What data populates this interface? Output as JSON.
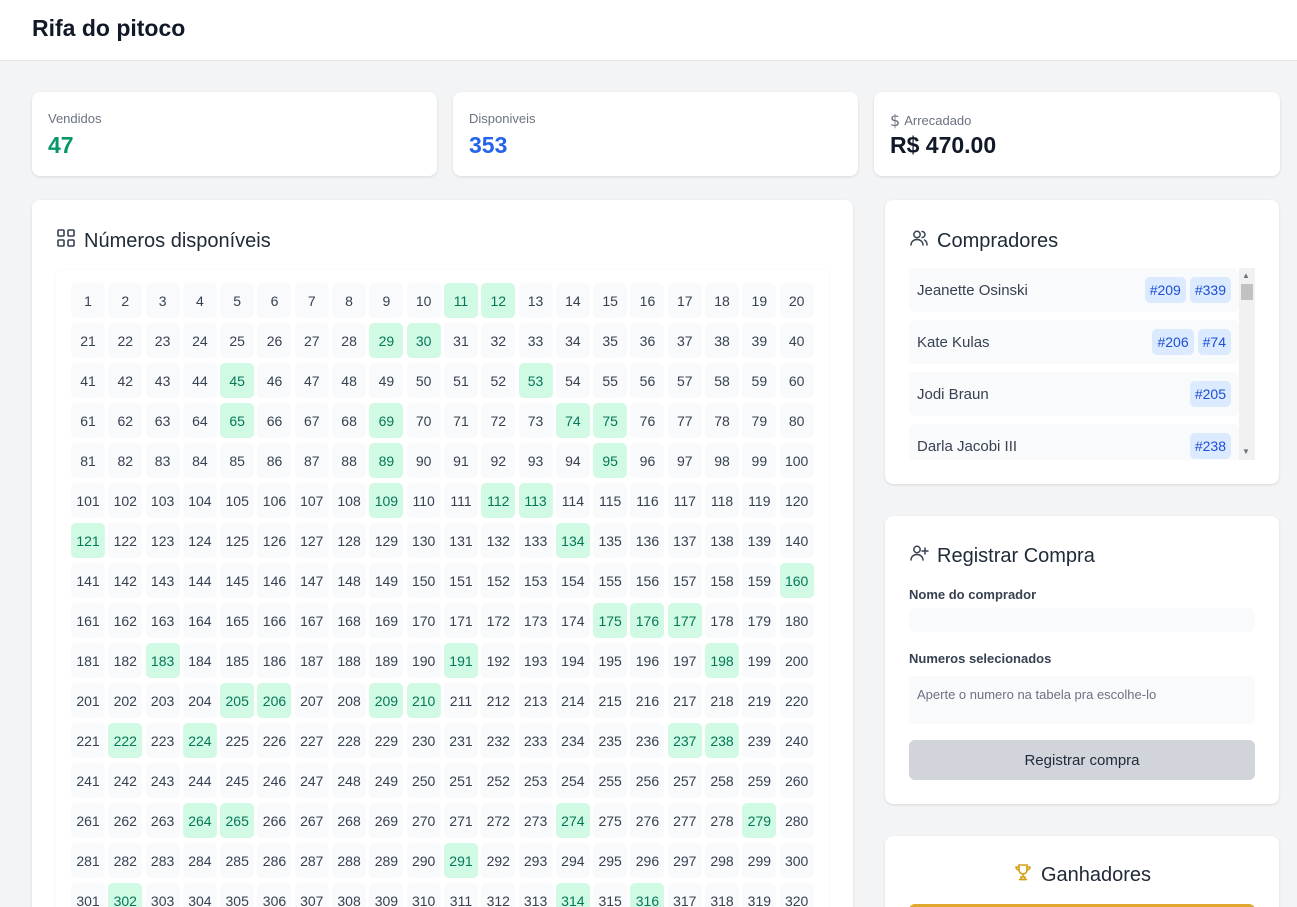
{
  "app": {
    "title": "Rifa do pitoco"
  },
  "stats": {
    "sold": {
      "label": "Vendidos",
      "value": "47",
      "color": "#059669"
    },
    "available": {
      "label": "Disponiveis",
      "value": "353",
      "color": "#2563eb"
    },
    "collected": {
      "label": "Arrecadado",
      "value": "R$ 470.00",
      "icon": "dollar-icon"
    }
  },
  "numbers": {
    "title": "Números disponíveis",
    "icon": "grid-icon",
    "visible_start": 1,
    "visible_end": 320,
    "sold": [
      11,
      12,
      29,
      30,
      45,
      53,
      65,
      69,
      74,
      75,
      89,
      95,
      109,
      112,
      113,
      121,
      134,
      160,
      175,
      176,
      177,
      183,
      191,
      198,
      205,
      206,
      209,
      210,
      222,
      224,
      237,
      238,
      264,
      265,
      274,
      279,
      291,
      302,
      314,
      316
    ]
  },
  "buyers": {
    "title": "Compradores",
    "icon": "users-icon",
    "items": [
      {
        "name": "Jeanette Osinski",
        "numbers": [
          "#209",
          "#339"
        ]
      },
      {
        "name": "Kate Kulas",
        "numbers": [
          "#206",
          "#74"
        ]
      },
      {
        "name": "Jodi Braun",
        "numbers": [
          "#205"
        ]
      },
      {
        "name": "Darla Jacobi III",
        "numbers": [
          "#238"
        ]
      }
    ]
  },
  "register": {
    "title": "Registrar Compra",
    "icon": "user-plus-icon",
    "name_label": "Nome do comprador",
    "name_value": "",
    "numbers_label": "Numeros selecionados",
    "numbers_placeholder": "Aperte o numero na tabela pra escolhe-lo",
    "submit_label": "Registrar compra"
  },
  "winners": {
    "title": "Ganhadores",
    "icon": "trophy-icon",
    "accent": "#e0a82e"
  }
}
